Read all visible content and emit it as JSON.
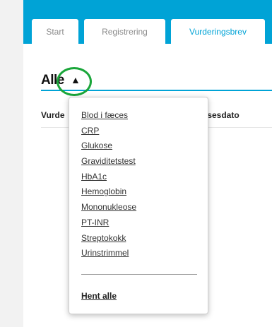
{
  "tabs": [
    {
      "label": "Start"
    },
    {
      "label": "Registrering"
    },
    {
      "label": "Vurderingsbrev"
    }
  ],
  "filter": {
    "selected": "Alle",
    "caret": "▲"
  },
  "table": {
    "headers": [
      "Vurde",
      "lsesdato"
    ]
  },
  "dropdown": {
    "items": [
      "Blod i fæces",
      "CRP",
      "Glukose",
      "Graviditetstest",
      "HbA1c",
      "Hemoglobin",
      "Mononukleose",
      "PT-INR",
      "Streptokokk",
      "Urinstrimmel"
    ],
    "fetch_all": "Hent alle"
  },
  "colors": {
    "accent": "#00a3d6",
    "highlight": "#1aa63a"
  }
}
